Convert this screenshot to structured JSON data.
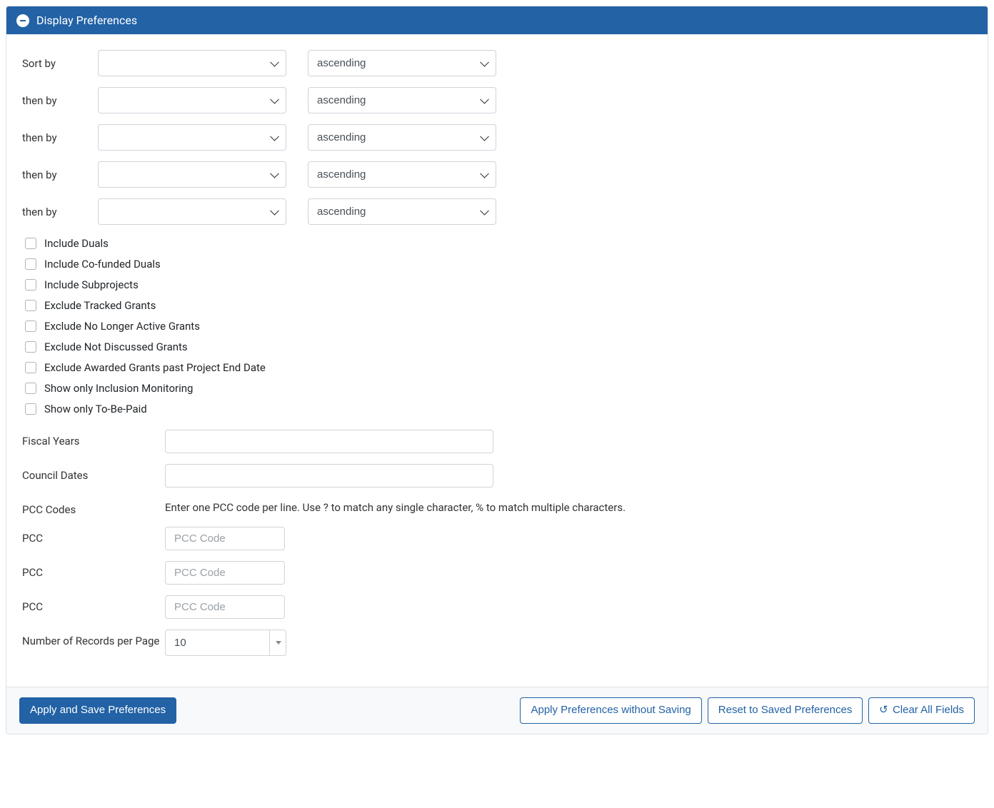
{
  "panel": {
    "title": "Display Preferences"
  },
  "sort": {
    "rows": [
      {
        "label": "Sort by",
        "field": "",
        "order": "ascending"
      },
      {
        "label": "then by",
        "field": "",
        "order": "ascending"
      },
      {
        "label": "then by",
        "field": "",
        "order": "ascending"
      },
      {
        "label": "then by",
        "field": "",
        "order": "ascending"
      },
      {
        "label": "then by",
        "field": "",
        "order": "ascending"
      }
    ]
  },
  "checkboxes": [
    {
      "label": "Include Duals",
      "checked": false
    },
    {
      "label": "Include Co-funded Duals",
      "checked": false
    },
    {
      "label": "Include Subprojects",
      "checked": false
    },
    {
      "label": "Exclude Tracked Grants",
      "checked": false
    },
    {
      "label": "Exclude No Longer Active Grants",
      "checked": false
    },
    {
      "label": "Exclude Not Discussed Grants",
      "checked": false
    },
    {
      "label": "Exclude Awarded Grants past Project End Date",
      "checked": false
    },
    {
      "label": "Show only Inclusion Monitoring",
      "checked": false
    },
    {
      "label": "Show only To-Be-Paid",
      "checked": false
    }
  ],
  "fields": {
    "fiscal_years": {
      "label": "Fiscal Years",
      "value": ""
    },
    "council_dates": {
      "label": "Council Dates",
      "value": ""
    },
    "pcc_codes": {
      "label": "PCC Codes",
      "instructions": "Enter one PCC code per line. Use ? to match any single character, % to match multiple characters."
    },
    "pcc": [
      {
        "label": "PCC",
        "value": "",
        "placeholder": "PCC Code"
      },
      {
        "label": "PCC",
        "value": "",
        "placeholder": "PCC Code"
      },
      {
        "label": "PCC",
        "value": "",
        "placeholder": "PCC Code"
      }
    ],
    "records_per_page": {
      "label": "Number of Records per Page",
      "value": "10"
    }
  },
  "buttons": {
    "apply_save": "Apply and Save Preferences",
    "apply_no_save": "Apply Preferences without Saving",
    "reset": "Reset to Saved Preferences",
    "clear": "Clear All Fields"
  }
}
